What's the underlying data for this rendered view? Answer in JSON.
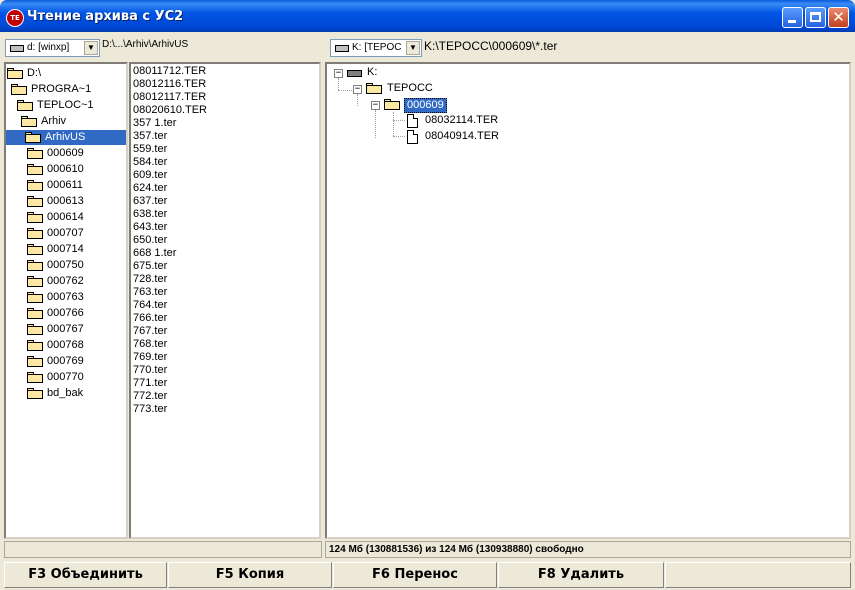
{
  "window": {
    "title": "Чтение архива с УС2",
    "icon_text": "TE"
  },
  "left_panel": {
    "drive": "d: [winxp]",
    "path": "D:\\...\\Arhiv\\ArhivUS",
    "tree": [
      {
        "label": "D:\\",
        "level": 0,
        "open": true
      },
      {
        "label": "PROGRA~1",
        "level": 1,
        "open": true
      },
      {
        "label": "TEPLOC~1",
        "level": 2,
        "open": true
      },
      {
        "label": "Arhiv",
        "level": 3,
        "open": true
      },
      {
        "label": "ArhivUS",
        "level": 4,
        "open": true,
        "selected": true
      },
      {
        "label": "000609",
        "level": 5
      },
      {
        "label": "000610",
        "level": 5
      },
      {
        "label": "000611",
        "level": 5
      },
      {
        "label": "000613",
        "level": 5
      },
      {
        "label": "000614",
        "level": 5
      },
      {
        "label": "000707",
        "level": 5
      },
      {
        "label": "000714",
        "level": 5
      },
      {
        "label": "000750",
        "level": 5
      },
      {
        "label": "000762",
        "level": 5
      },
      {
        "label": "000763",
        "level": 5
      },
      {
        "label": "000766",
        "level": 5
      },
      {
        "label": "000767",
        "level": 5
      },
      {
        "label": "000768",
        "level": 5
      },
      {
        "label": "000769",
        "level": 5
      },
      {
        "label": "000770",
        "level": 5
      },
      {
        "label": "bd_bak",
        "level": 5
      }
    ],
    "files": [
      "08011712.TER",
      "08012116.TER",
      "08012117.TER",
      "08020610.TER",
      "357 1.ter",
      "357.ter",
      "559.ter",
      "584.ter",
      "609.ter",
      "624.ter",
      "637.ter",
      "638.ter",
      "643.ter",
      "650.ter",
      "668 1.ter",
      "675.ter",
      "728.ter",
      "763.ter",
      "764.ter",
      "766.ter",
      "767.ter",
      "768.ter",
      "769.ter",
      "770.ter",
      "771.ter",
      "772.ter",
      "773.ter"
    ]
  },
  "right_panel": {
    "drive": "K: [TEPOC",
    "path": "K:\\TEPOCC\\000609\\*.ter",
    "tree": {
      "root": "K:",
      "folder": "TEPOCC",
      "subfolder": "000609",
      "files": [
        "08032114.TER",
        "08040914.TER"
      ]
    },
    "status": "124 Мб (130881536) из 124 Мб (130938880) свободно"
  },
  "left_status": "",
  "function_keys": [
    {
      "label": "F3 Объединить"
    },
    {
      "label": "F5 Копия"
    },
    {
      "label": "F6 Перенос"
    },
    {
      "label": "F8 Удалить"
    },
    {
      "label": ""
    }
  ]
}
